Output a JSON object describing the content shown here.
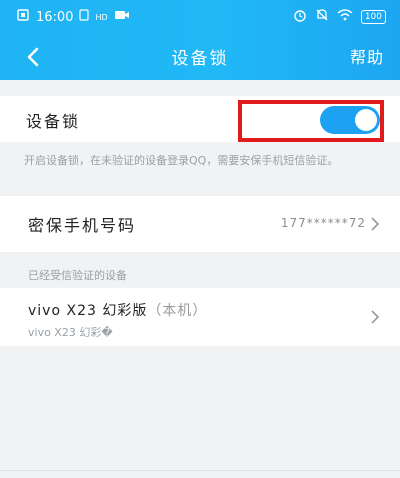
{
  "status_bar": {
    "time": "16:00",
    "battery": "100"
  },
  "nav": {
    "title": "设备锁",
    "help": "帮助"
  },
  "device_lock": {
    "label": "设备锁",
    "enabled": true,
    "description": "开启设备锁，在未验证的设备登录QQ，需要安保手机短信验证。"
  },
  "secure_phone": {
    "label": "密保手机号码",
    "value": "177******72"
  },
  "verified_devices": {
    "section_title": "已经受信验证的设备",
    "items": [
      {
        "name": "vivo X23 幻彩版",
        "tag": "（本机）",
        "model": "vivo X23 幻彩�"
      }
    ]
  },
  "colors": {
    "header_blue": "#21b8f6",
    "toggle_on": "#1da1f2",
    "highlight_red": "#e11b1b"
  }
}
